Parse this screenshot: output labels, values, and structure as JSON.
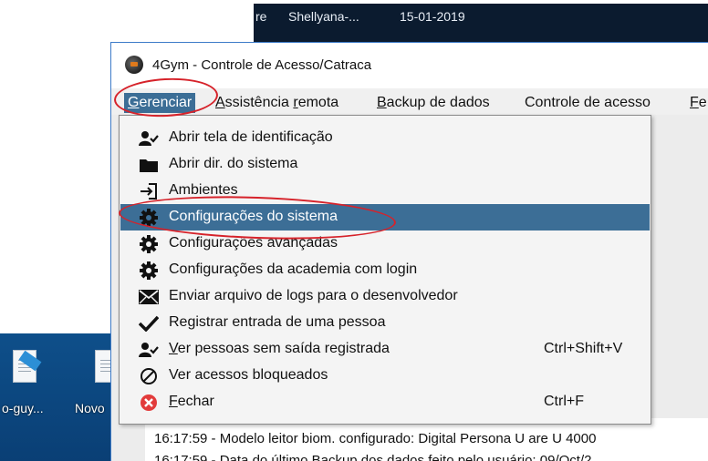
{
  "window": {
    "title": "4Gym - Controle de Acesso/Catraca"
  },
  "taskbar": {
    "items": [
      "re",
      "Shellyana-...",
      "15-01-2019"
    ]
  },
  "desktop": {
    "icons": [
      {
        "label": "o-guy...",
        "icon": "document-icon"
      },
      {
        "label": "Novo",
        "icon": "document-icon"
      }
    ]
  },
  "menubar": {
    "items": [
      {
        "label": "Gerenciar",
        "mnemonic": "G",
        "active": true
      },
      {
        "label": "Assistência remota",
        "mnemonic": "A",
        "active": false
      },
      {
        "label": "Backup de dados",
        "mnemonic": "B",
        "active": false
      },
      {
        "label": "Controle de acesso",
        "mnemonic": "",
        "active": false
      },
      {
        "label": "Fe",
        "mnemonic": "F",
        "active": false
      }
    ]
  },
  "dropdown": {
    "items": [
      {
        "label": "Abrir tela de identificação",
        "icon": "user-check-icon",
        "shortcut": ""
      },
      {
        "label": "Abrir dir. do sistema",
        "icon": "folder-icon",
        "shortcut": ""
      },
      {
        "label": "Ambientes",
        "icon": "sign-in-icon",
        "shortcut": ""
      },
      {
        "label": "Configurações do sistema",
        "icon": "gear-icon",
        "shortcut": "",
        "selected": true
      },
      {
        "label": "Configurações avançadas",
        "icon": "gear-icon",
        "shortcut": ""
      },
      {
        "label": "Configurações da academia com login",
        "icon": "gear-icon",
        "shortcut": ""
      },
      {
        "label": "Enviar arquivo de logs para o desenvolvedor",
        "icon": "envelope-icon",
        "shortcut": ""
      },
      {
        "label": "Registrar entrada de uma pessoa",
        "icon": "check-icon",
        "shortcut": ""
      },
      {
        "label": "Ver pessoas sem saída registrada",
        "icon": "user-check-icon",
        "shortcut": "Ctrl+Shift+V"
      },
      {
        "label": "Ver acessos bloqueados",
        "icon": "blocked-icon",
        "shortcut": ""
      },
      {
        "label": "Fechar",
        "icon": "close-circle-icon",
        "shortcut": "Ctrl+F"
      }
    ]
  },
  "log": {
    "lines": [
      "16:17:59 - Modelo leitor biom. configurado: Digital Persona U are U 4000",
      "16:17:59 - Data do último Backup dos dados feito pelo usuário: 09/Oct/2"
    ]
  },
  "colors": {
    "menu_highlight": "#3c6e96",
    "annotation": "#d6222a",
    "close_icon": "#e23b3b"
  }
}
